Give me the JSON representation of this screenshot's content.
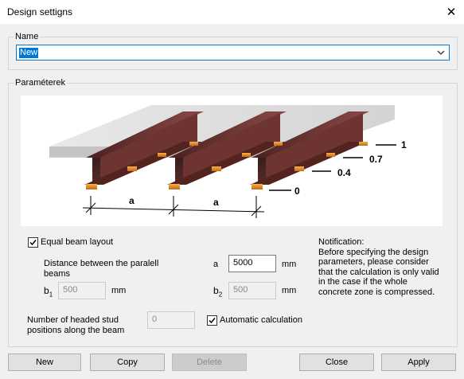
{
  "window": {
    "title": "Design settigns"
  },
  "name_group": {
    "legend": "Name",
    "value": "New"
  },
  "params_group": {
    "legend": "Paraméterek"
  },
  "diagram": {
    "labels": {
      "one": "1",
      "p07": "0.7",
      "p04": "0.4",
      "zero": "0",
      "a": "a"
    }
  },
  "equal_beam": {
    "label": "Equal beam layout",
    "checked": true
  },
  "distance": {
    "label_line1": "Distance between the paralell",
    "label_line2": "beams",
    "a_label": "a",
    "a_value": "5000",
    "a_unit": "mm"
  },
  "b1": {
    "label": "b",
    "sub": "1",
    "value": "500",
    "unit": "mm"
  },
  "b2": {
    "label": "b",
    "sub": "2",
    "value": "500",
    "unit": "mm"
  },
  "studs": {
    "label_line1": "Number of headed stud",
    "label_line2": "positions along the beam",
    "value": "0"
  },
  "auto_calc": {
    "label": "Automatic calculation",
    "checked": true
  },
  "notification": {
    "lines": [
      "Notification:",
      "Before specifying the design",
      "parameters, please consider",
      "that the calculation is only valid",
      "in the case if the whole",
      "concrete zone is compressed."
    ]
  },
  "buttons": {
    "new": "New",
    "copy": "Copy",
    "delete": "Delete",
    "close": "Close",
    "apply": "Apply"
  }
}
